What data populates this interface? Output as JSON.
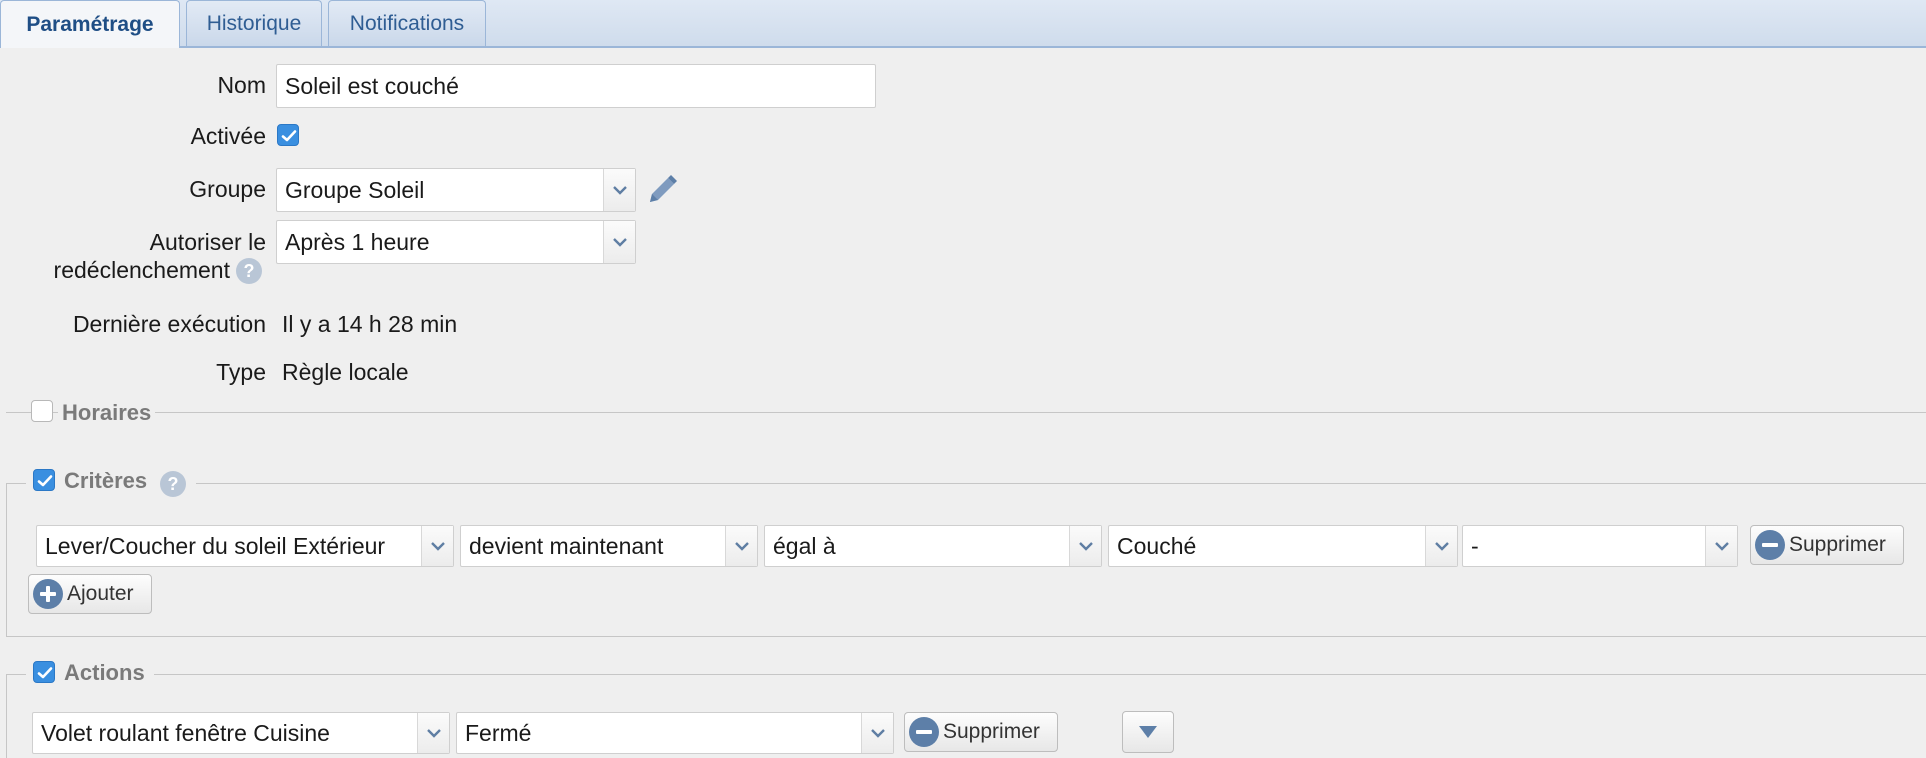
{
  "tabs": [
    {
      "label": "Paramétrage",
      "active": true
    },
    {
      "label": "Historique",
      "active": false
    },
    {
      "label": "Notifications",
      "active": false
    }
  ],
  "form": {
    "name_label": "Nom",
    "name_value": "Soleil est couché",
    "enabled_label": "Activée",
    "enabled_checked": true,
    "group_label": "Groupe",
    "group_value": "Groupe Soleil",
    "retrigger_label_line1": "Autoriser le",
    "retrigger_label_line2": "redéclenchement",
    "retrigger_value": "Après 1 heure",
    "last_run_label": "Dernière exécution",
    "last_run_value": "Il y a 14 h 28 min",
    "type_label": "Type",
    "type_value": "Règle locale"
  },
  "schedules": {
    "label": "Horaires",
    "checked": false
  },
  "criteria": {
    "label": "Critères",
    "checked": true,
    "row": {
      "device": "Lever/Coucher du soleil Extérieur",
      "trigger": "devient maintenant",
      "operator": "égal à",
      "value": "Couché",
      "extra": "-",
      "delete_label": "Supprimer"
    },
    "add_label": "Ajouter"
  },
  "actions": {
    "label": "Actions",
    "checked": true,
    "row": {
      "device": "Volet roulant fenêtre Cuisine",
      "value": "Fermé",
      "delete_label": "Supprimer"
    }
  },
  "colors": {
    "accent": "#3a8fe0",
    "tab_text": "#2f5d93",
    "icon_blue": "#5d7fa8"
  }
}
